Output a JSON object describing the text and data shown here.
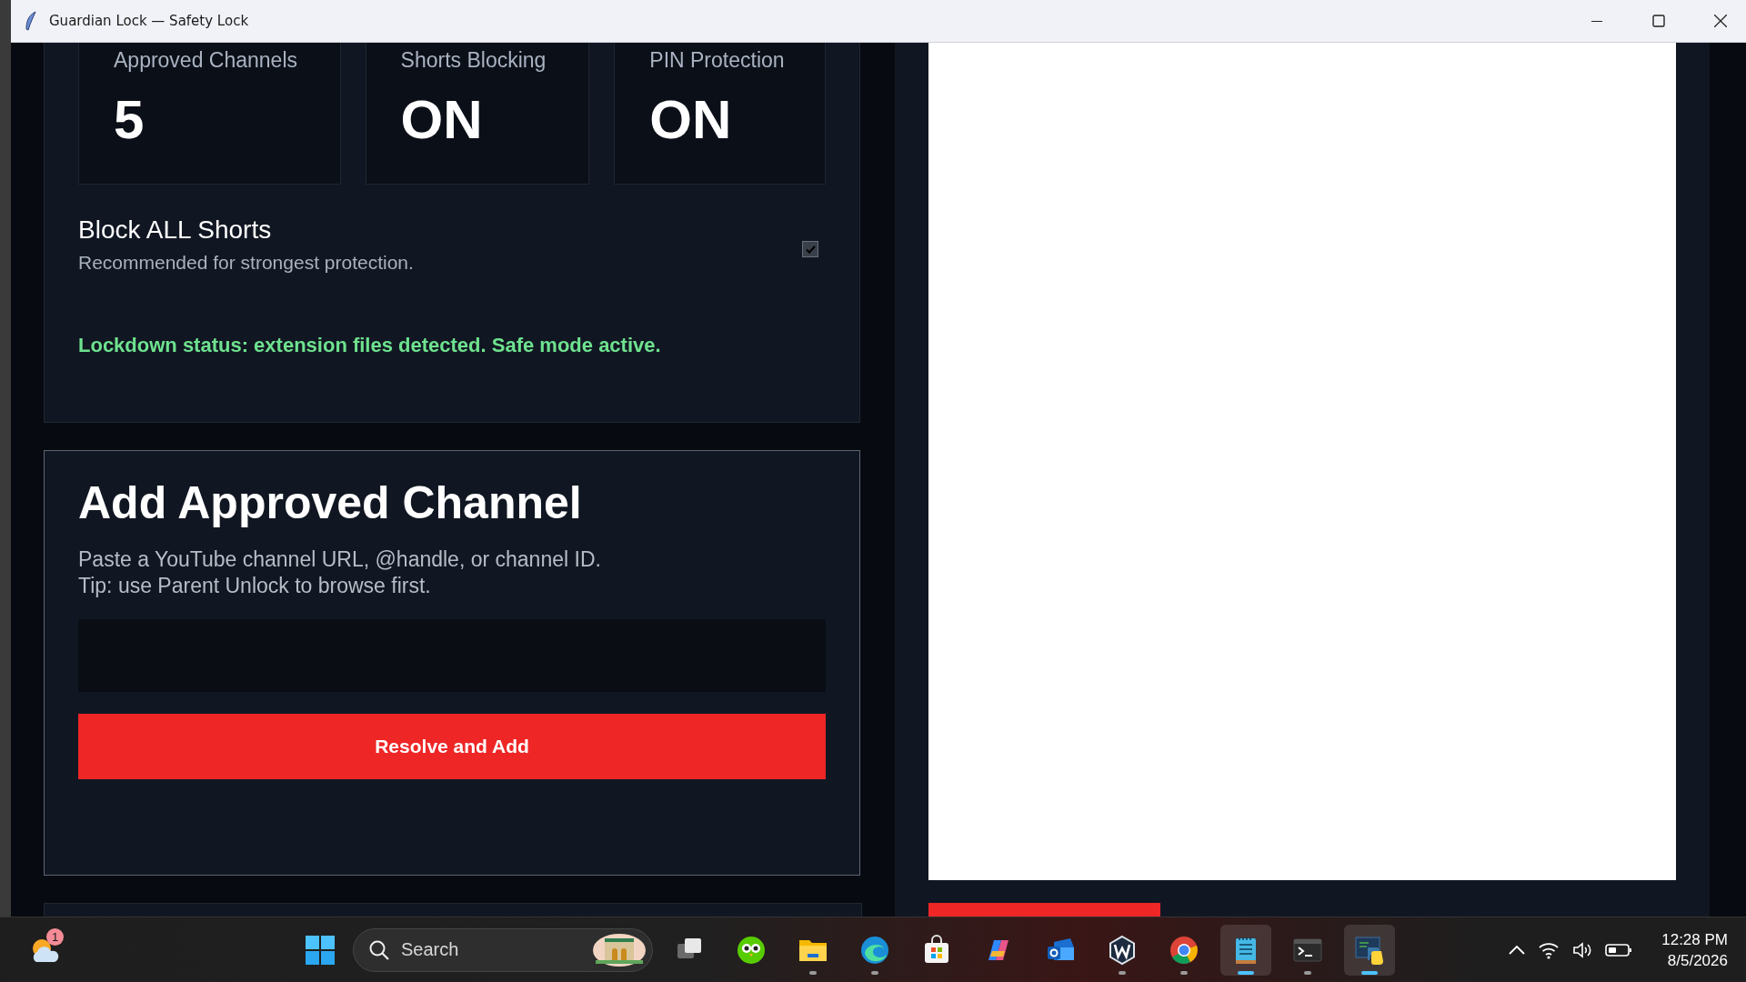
{
  "window": {
    "title": "Guardian Lock — Safety Lock"
  },
  "stats": [
    {
      "label": "Approved Channels",
      "value": "5"
    },
    {
      "label": "Shorts Blocking",
      "value": "ON"
    },
    {
      "label": "PIN Protection",
      "value": "ON"
    }
  ],
  "block_shorts": {
    "label": "Block ALL Shorts",
    "description": "Recommended for strongest protection.",
    "checked": true
  },
  "status": "Lockdown status: extension files detected. Safe mode active.",
  "add_channel": {
    "title": "Add Approved Channel",
    "help": [
      "Paste a YouTube channel URL, @handle, or channel ID.",
      "Tip: use Parent Unlock to browse first."
    ],
    "button": "Resolve and Add"
  },
  "taskbar": {
    "weather_badge": "1",
    "search": {
      "placeholder": "Search"
    },
    "apps": [
      {
        "kind": "task-view",
        "running": false,
        "selected": false
      },
      {
        "kind": "owl",
        "running": false,
        "selected": false
      },
      {
        "kind": "folder",
        "running": true,
        "selected": false
      },
      {
        "kind": "swirl",
        "running": true,
        "selected": false
      },
      {
        "kind": "bag",
        "running": false,
        "selected": false
      },
      {
        "kind": "ribbon",
        "running": false,
        "selected": false
      },
      {
        "kind": "envelope",
        "running": false,
        "selected": false
      },
      {
        "kind": "hexagon",
        "running": true,
        "selected": false
      },
      {
        "kind": "chrome",
        "running": true,
        "selected": false
      },
      {
        "kind": "notepad",
        "running": true,
        "selected": true
      },
      {
        "kind": "terminal",
        "running": true,
        "selected": false
      },
      {
        "kind": "python",
        "running": true,
        "selected": true
      }
    ],
    "clock": {
      "time": "12:28 PM",
      "date": "8/5/2026"
    }
  }
}
